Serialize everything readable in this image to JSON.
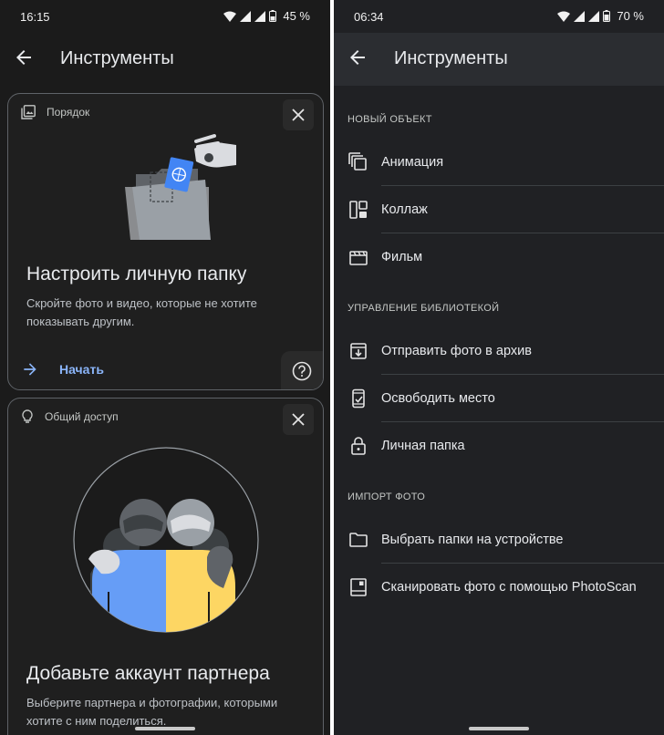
{
  "left": {
    "status": {
      "time": "16:15",
      "battery": "45 %"
    },
    "appbar": {
      "title": "Инструменты"
    },
    "card1": {
      "chip": "Порядок",
      "heading": "Настроить личную папку",
      "description": "Скройте фото и видео, которые не хотите показывать другим.",
      "cta": "Начать"
    },
    "card2": {
      "chip": "Общий доступ",
      "heading": "Добавьте аккаунт партнера",
      "description": "Выберите партнера и фотографии, которыми хотите с ним поделиться."
    }
  },
  "right": {
    "status": {
      "time": "06:34",
      "battery": "70 %"
    },
    "appbar": {
      "title": "Инструменты"
    },
    "sections": [
      {
        "title": "НОВЫЙ ОБЪЕКТ",
        "items": [
          {
            "label": "Анимация",
            "icon": "animation-icon"
          },
          {
            "label": "Коллаж",
            "icon": "collage-icon"
          },
          {
            "label": "Фильм",
            "icon": "movie-icon"
          }
        ]
      },
      {
        "title": "УПРАВЛЕНИЕ БИБЛИОТЕКОЙ",
        "items": [
          {
            "label": "Отправить фото в архив",
            "icon": "archive-icon"
          },
          {
            "label": "Освободить место",
            "icon": "free-space-icon"
          },
          {
            "label": "Личная папка",
            "icon": "lock-icon"
          }
        ]
      },
      {
        "title": "ИМПОРТ ФОТО",
        "items": [
          {
            "label": "Выбрать папки на устройстве",
            "icon": "folder-icon"
          },
          {
            "label": "Сканировать фото с помощью PhotoScan",
            "icon": "photoscan-icon"
          }
        ]
      }
    ]
  },
  "colors": {
    "accent": "#8ab4f8",
    "left_bg": "#1b1b1b",
    "right_bg": "#202124",
    "google_blue": "#669df6",
    "google_yellow": "#fdd663"
  }
}
